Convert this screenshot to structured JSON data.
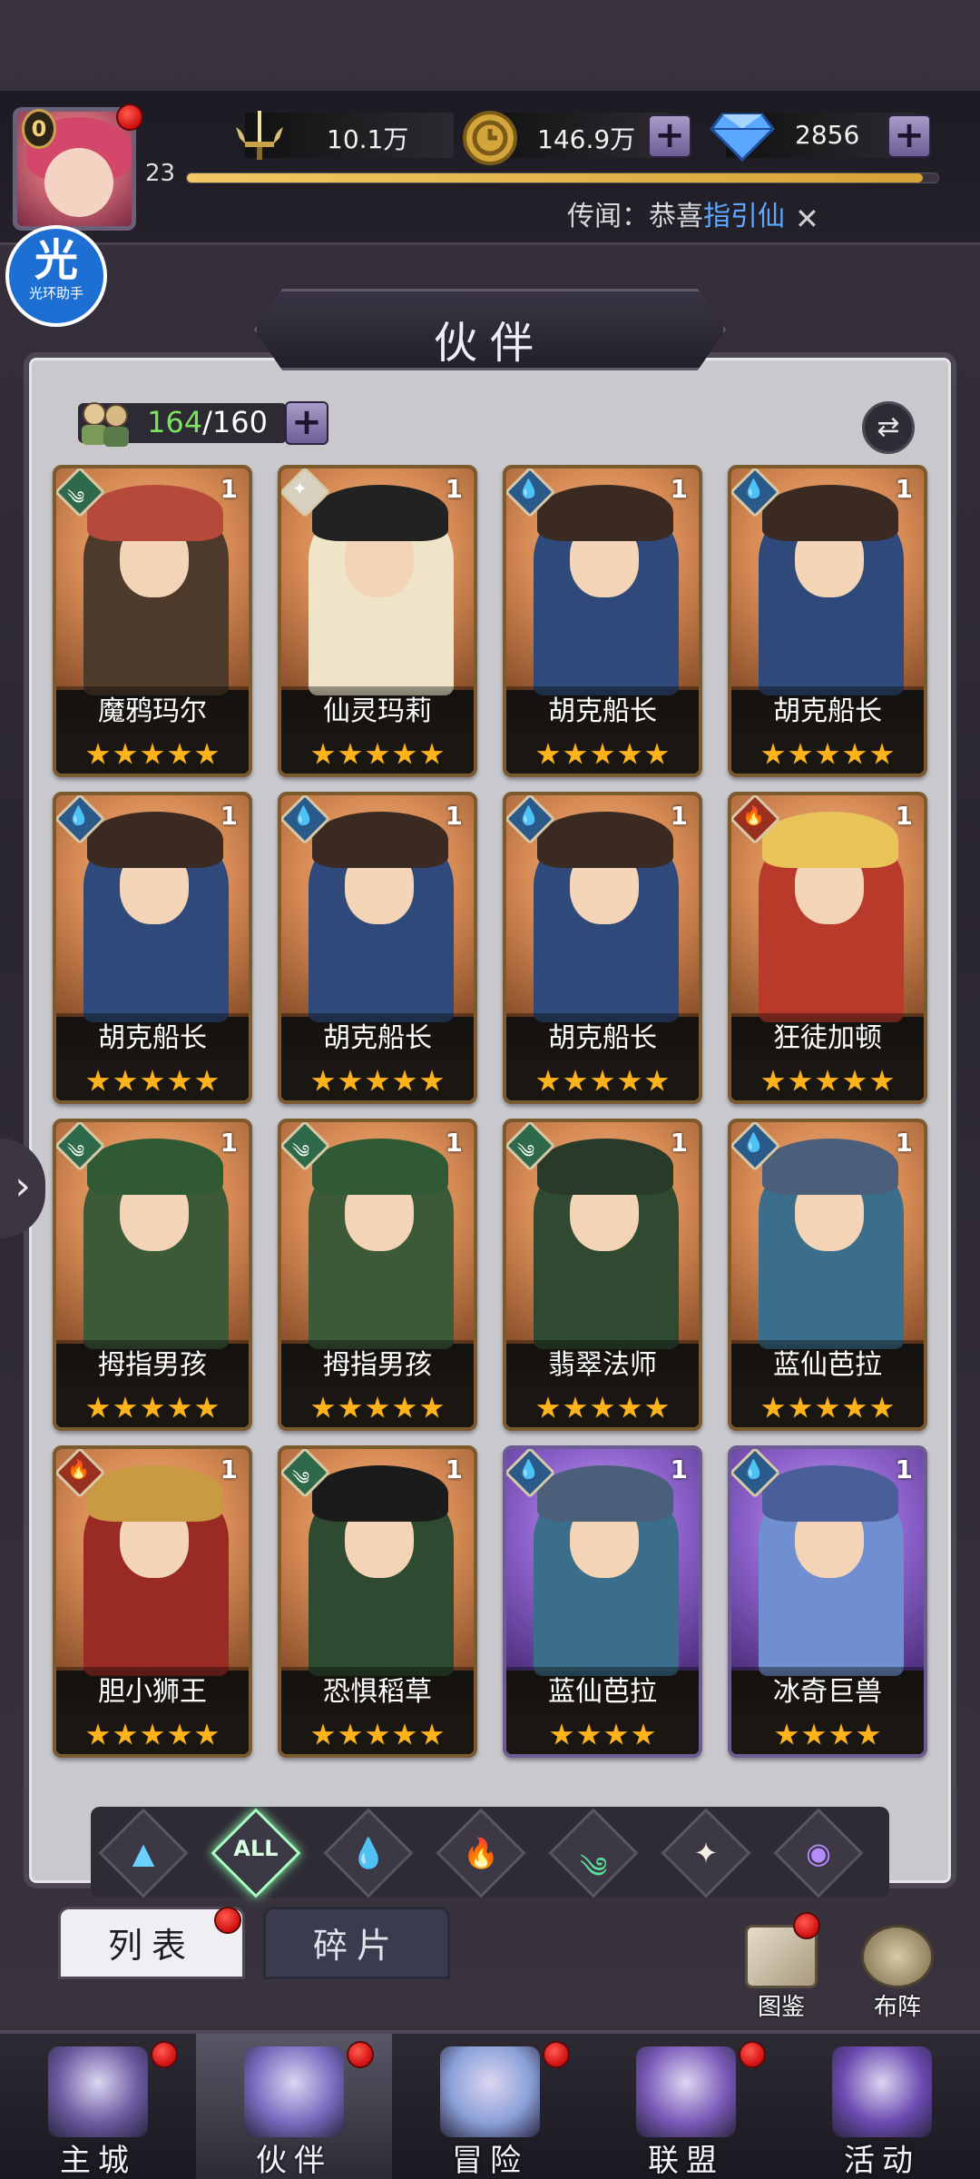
{
  "header": {
    "vip_level": "0",
    "player_level": "23",
    "xp_fraction": 0.98,
    "power": "10.1万",
    "gold": "146.9万",
    "diamonds": "2856",
    "rumor_prefix": "传闻：恭喜",
    "rumor_highlight": "指引仙"
  },
  "helper": {
    "big": "光",
    "small": "光环助手"
  },
  "page_title": "伙伴",
  "roster": {
    "current": "164",
    "capacity": "/160"
  },
  "cards": [
    {
      "name": "魔鸦玛尔",
      "level": "1",
      "stars": 5,
      "frame": "orange",
      "element": "wind",
      "color": "#4e3a2a",
      "hat": "#b54a3a"
    },
    {
      "name": "仙灵玛莉",
      "level": "1",
      "stars": 5,
      "frame": "orange",
      "element": "light",
      "color": "#efe4c8",
      "hat": "#222222"
    },
    {
      "name": "胡克船长",
      "level": "1",
      "stars": 5,
      "frame": "orange",
      "element": "water",
      "color": "#2f4a7a",
      "hat": "#3a2a22"
    },
    {
      "name": "胡克船长",
      "level": "1",
      "stars": 5,
      "frame": "orange",
      "element": "water",
      "color": "#2f4a7a",
      "hat": "#3a2a22"
    },
    {
      "name": "胡克船长",
      "level": "1",
      "stars": 5,
      "frame": "orange",
      "element": "water",
      "color": "#2f4a7a",
      "hat": "#3a2a22"
    },
    {
      "name": "胡克船长",
      "level": "1",
      "stars": 5,
      "frame": "orange",
      "element": "water",
      "color": "#2f4a7a",
      "hat": "#3a2a22"
    },
    {
      "name": "胡克船长",
      "level": "1",
      "stars": 5,
      "frame": "orange",
      "element": "water",
      "color": "#2f4a7a",
      "hat": "#3a2a22"
    },
    {
      "name": "狂徒加顿",
      "level": "1",
      "stars": 5,
      "frame": "orange",
      "element": "fire",
      "color": "#b83a2a",
      "hat": "#e8c35a"
    },
    {
      "name": "拇指男孩",
      "level": "1",
      "stars": 5,
      "frame": "orange",
      "element": "wind",
      "color": "#3c5a38",
      "hat": "#2f5a34"
    },
    {
      "name": "拇指男孩",
      "level": "1",
      "stars": 5,
      "frame": "orange",
      "element": "wind",
      "color": "#3c5a38",
      "hat": "#2f5a34"
    },
    {
      "name": "翡翠法师",
      "level": "1",
      "stars": 5,
      "frame": "orange",
      "element": "wind",
      "color": "#2f4a30",
      "hat": "#2a3a28"
    },
    {
      "name": "蓝仙芭拉",
      "level": "1",
      "stars": 5,
      "frame": "orange",
      "element": "water",
      "color": "#3a6e8a",
      "hat": "#4b5f7a"
    },
    {
      "name": "胆小狮王",
      "level": "1",
      "stars": 5,
      "frame": "orange",
      "element": "fire",
      "color": "#9a2a24",
      "hat": "#c99a42"
    },
    {
      "name": "恐惧稻草",
      "level": "1",
      "stars": 5,
      "frame": "orange",
      "element": "wind",
      "color": "#2e4a30",
      "hat": "#1b1b1b"
    },
    {
      "name": "蓝仙芭拉",
      "level": "1",
      "stars": 4,
      "frame": "purple",
      "element": "water",
      "color": "#3a6e8a",
      "hat": "#4b5f7a"
    },
    {
      "name": "冰奇巨兽",
      "level": "1",
      "stars": 4,
      "frame": "purple",
      "element": "water",
      "color": "#6f8fd0",
      "hat": "#4a5e9a"
    }
  ],
  "filters": [
    {
      "name": "filter-dark",
      "glyph": "▲",
      "color": "#6ad0ff"
    },
    {
      "name": "filter-all",
      "glyph": "ALL",
      "color": "#d9ffe4"
    },
    {
      "name": "filter-water",
      "glyph": "💧",
      "color": "#6aa8ff"
    },
    {
      "name": "filter-fire",
      "glyph": "🔥",
      "color": "#ff6a4a"
    },
    {
      "name": "filter-wind",
      "glyph": "༄",
      "color": "#5ae09a"
    },
    {
      "name": "filter-light",
      "glyph": "✦",
      "color": "#f3efe0"
    },
    {
      "name": "filter-void",
      "glyph": "◉",
      "color": "#b68bff"
    }
  ],
  "subtabs": {
    "list": "列表",
    "fragments": "碎片"
  },
  "side_buttons": {
    "codex": "图鉴",
    "formation": "布阵"
  },
  "nav": [
    {
      "label": "主城",
      "color": "#6a5aa0"
    },
    {
      "label": "伙伴",
      "color": "#7a6abf"
    },
    {
      "label": "冒险",
      "color": "#8aa0d8"
    },
    {
      "label": "联盟",
      "color": "#7a5ab8"
    },
    {
      "label": "活动",
      "color": "#6a4ab0"
    }
  ],
  "colors": {
    "accent_gold": "#ffb21a",
    "notify_red": "#d01010",
    "roster_green": "#7be35c"
  }
}
